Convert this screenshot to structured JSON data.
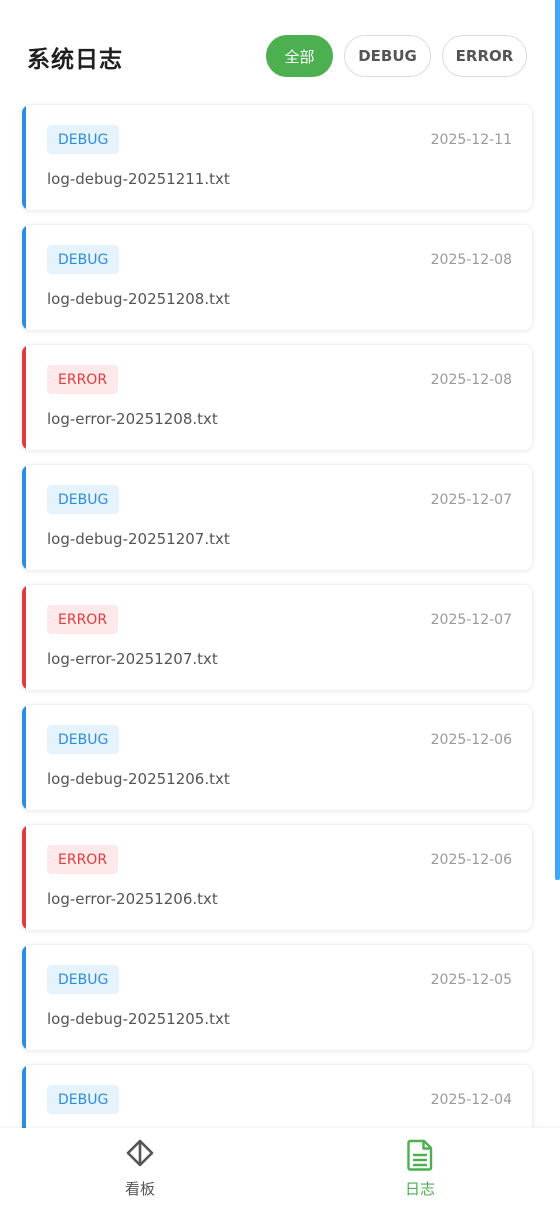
{
  "header": {
    "title": "系统日志"
  },
  "filters": [
    {
      "id": "all",
      "label": "全部",
      "active": true
    },
    {
      "id": "debug",
      "label": "DEBUG",
      "active": false
    },
    {
      "id": "error",
      "label": "ERROR",
      "active": false
    }
  ],
  "colors": {
    "accent_green": "#4caf50",
    "debug_blue": "#2a8ee0",
    "error_red": "#e23b3b"
  },
  "logs": [
    {
      "level": "DEBUG",
      "date": "2025-12-11",
      "file": "log-debug-20251211.txt"
    },
    {
      "level": "DEBUG",
      "date": "2025-12-08",
      "file": "log-debug-20251208.txt"
    },
    {
      "level": "ERROR",
      "date": "2025-12-08",
      "file": "log-error-20251208.txt"
    },
    {
      "level": "DEBUG",
      "date": "2025-12-07",
      "file": "log-debug-20251207.txt"
    },
    {
      "level": "ERROR",
      "date": "2025-12-07",
      "file": "log-error-20251207.txt"
    },
    {
      "level": "DEBUG",
      "date": "2025-12-06",
      "file": "log-debug-20251206.txt"
    },
    {
      "level": "ERROR",
      "date": "2025-12-06",
      "file": "log-error-20251206.txt"
    },
    {
      "level": "DEBUG",
      "date": "2025-12-05",
      "file": "log-debug-20251205.txt"
    },
    {
      "level": "DEBUG",
      "date": "2025-12-04",
      "file": ""
    }
  ],
  "nav": [
    {
      "id": "dashboard",
      "label": "看板",
      "icon": "diamond-icon",
      "active": false
    },
    {
      "id": "logs",
      "label": "日志",
      "icon": "document-icon",
      "active": true
    }
  ]
}
